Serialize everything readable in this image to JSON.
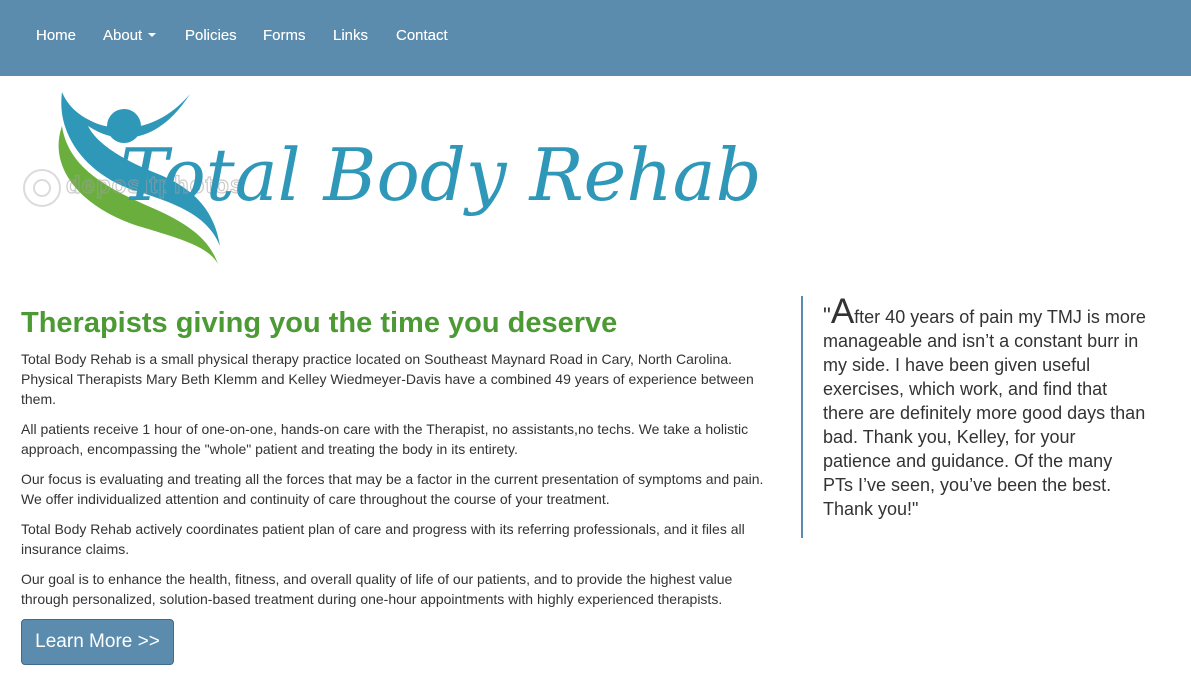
{
  "nav": {
    "items": [
      {
        "label": "Home"
      },
      {
        "label": "About"
      },
      {
        "label": "Policies"
      },
      {
        "label": "Forms"
      },
      {
        "label": "Links"
      },
      {
        "label": "Contact"
      }
    ]
  },
  "logo": {
    "text": "Total Body Rehab",
    "watermark": "depositphotos"
  },
  "main": {
    "headline": "Therapists giving you the time you deserve",
    "paragraphs": [
      "Total Body Rehab is a small physical therapy practice located on Southeast Maynard Road in Cary, North Carolina. Physical Therapists Mary Beth Klemm and Kelley Wiedmeyer-Davis have a combined 49 years of experience between them.",
      "All patients receive 1 hour of one-on-one, hands-on care with the Therapist, no assistants,no techs. We take a holistic approach, encompassing the \"whole\" patient and treating the body in its entirety.",
      "Our focus is evaluating and treating all the forces that may be a factor in the current presentation of symptoms and pain. We offer individualized attention and continuity of care throughout the course of your treatment.",
      "Total Body Rehab actively coordinates patient plan of care and progress with its referring professionals, and it files all insurance claims.",
      "Our goal is to enhance the health, fitness, and overall quality of life of our patients, and to provide the highest value through personalized, solution-based treatment during one-hour appointments with highly experienced therapists."
    ],
    "button_label": "Learn More >>"
  },
  "testimonial": {
    "open_mark": "\"",
    "first_letter": "A",
    "text": "fter 40 years of pain my TMJ is more manageable and isn’t a constant burr in my side. I have been given useful exercises, which work, and find that there are definitely more good days than bad. Thank you, Kelley, for your patience and guidance. Of the many PTs I’ve seen, you’ve been the best. Thank you!\""
  },
  "colors": {
    "navbar": "#5b8bad",
    "headline": "#4c9a34",
    "logo_blue": "#2f98b9",
    "logo_green": "#6aaf3d"
  }
}
